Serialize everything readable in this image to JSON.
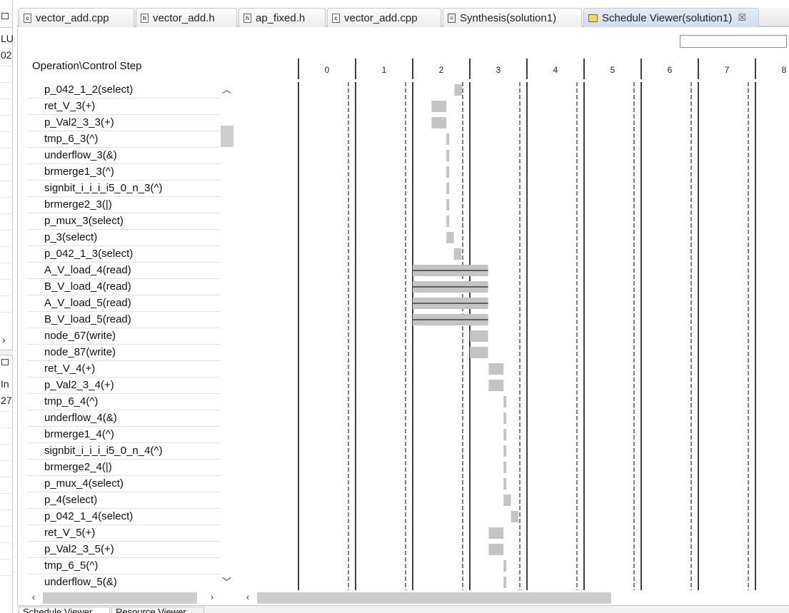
{
  "left_panel": {
    "snippets": [
      "LU",
      "02",
      "In",
      "27"
    ]
  },
  "tabs": [
    {
      "label": "vector_add.cpp",
      "icon": "cpp-file-icon",
      "active": false
    },
    {
      "label": "vector_add.h",
      "icon": "header-file-icon",
      "active": false
    },
    {
      "label": "ap_fixed.h",
      "icon": "header-file-icon",
      "active": false
    },
    {
      "label": "vector_add.cpp",
      "icon": "cpp-file-icon",
      "active": false
    },
    {
      "label": "Synthesis(solution1)",
      "icon": "synthesis-report-icon",
      "active": false
    },
    {
      "label": "Schedule Viewer(solution1)",
      "icon": "schedule-viewer-icon",
      "active": true,
      "close": "☒"
    }
  ],
  "schedule_viewer": {
    "header_title": "Operation\\Control Step",
    "filter_value": "",
    "control_steps": [
      "0",
      "1",
      "2",
      "3",
      "4",
      "5",
      "6",
      "7",
      "8"
    ],
    "operations": [
      {
        "label": "p_042_1_2(select)",
        "start": 2.73,
        "end": 2.86
      },
      {
        "label": "ret_V_3(+)",
        "start": 2.33,
        "end": 2.59
      },
      {
        "label": "p_Val2_3_3(+)",
        "start": 2.33,
        "end": 2.59
      },
      {
        "label": "tmp_6_3(^)",
        "start": 2.59,
        "end": 2.64
      },
      {
        "label": "underflow_3(&)",
        "start": 2.59,
        "end": 2.64
      },
      {
        "label": "brmerge1_3(^)",
        "start": 2.59,
        "end": 2.64
      },
      {
        "label": "signbit_i_i_i_i5_0_n_3(^)",
        "start": 2.59,
        "end": 2.64
      },
      {
        "label": "brmerge2_3(|)",
        "start": 2.59,
        "end": 2.64
      },
      {
        "label": "p_mux_3(select)",
        "start": 2.59,
        "end": 2.64
      },
      {
        "label": "p_3(select)",
        "start": 2.59,
        "end": 2.72
      },
      {
        "label": "p_042_1_3(select)",
        "start": 2.72,
        "end": 2.85
      },
      {
        "label": "A_V_load_4(read)",
        "start": 2.0,
        "end": 3.32,
        "multi": true
      },
      {
        "label": "B_V_load_4(read)",
        "start": 2.0,
        "end": 3.32,
        "multi": true
      },
      {
        "label": "A_V_load_5(read)",
        "start": 2.0,
        "end": 3.32,
        "multi": true
      },
      {
        "label": "B_V_load_5(read)",
        "start": 2.0,
        "end": 3.32,
        "multi": true
      },
      {
        "label": "node_67(write)",
        "start": 3.0,
        "end": 3.32
      },
      {
        "label": "node_87(write)",
        "start": 3.0,
        "end": 3.32
      },
      {
        "label": "ret_V_4(+)",
        "start": 3.33,
        "end": 3.59
      },
      {
        "label": "p_Val2_3_4(+)",
        "start": 3.33,
        "end": 3.59
      },
      {
        "label": "tmp_6_4(^)",
        "start": 3.59,
        "end": 3.64
      },
      {
        "label": "underflow_4(&)",
        "start": 3.59,
        "end": 3.64
      },
      {
        "label": "brmerge1_4(^)",
        "start": 3.59,
        "end": 3.64
      },
      {
        "label": "signbit_i_i_i_i5_0_n_4(^)",
        "start": 3.59,
        "end": 3.64
      },
      {
        "label": "brmerge2_4(|)",
        "start": 3.59,
        "end": 3.64
      },
      {
        "label": "p_mux_4(select)",
        "start": 3.59,
        "end": 3.64
      },
      {
        "label": "p_4(select)",
        "start": 3.59,
        "end": 3.72
      },
      {
        "label": "p_042_1_4(select)",
        "start": 3.72,
        "end": 3.85
      },
      {
        "label": "ret_V_5(+)",
        "start": 3.33,
        "end": 3.59
      },
      {
        "label": "p_Val2_3_5(+)",
        "start": 3.33,
        "end": 3.59
      },
      {
        "label": "tmp_6_5(^)",
        "start": 3.59,
        "end": 3.64
      },
      {
        "label": "underflow_5(&)",
        "start": 3.59,
        "end": 3.64
      }
    ]
  },
  "bottom_tabs": [
    "Schedule Viewer",
    "Resource Viewer"
  ],
  "colors": {
    "bar": "#c4c4c4",
    "grid": "#000000",
    "active_tab": "#d6e3f3"
  }
}
